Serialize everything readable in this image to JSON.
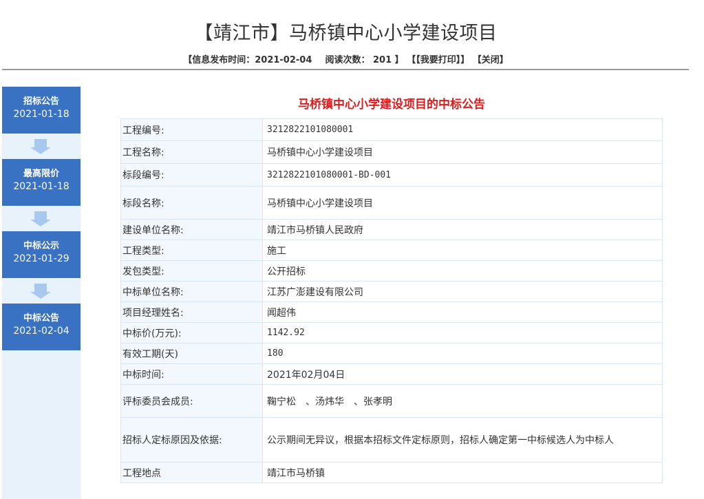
{
  "header": {
    "title": "【靖江市】马桥镇中心小学建设项目",
    "publish_label": "【信息发布时间：",
    "publish_date": "2021-02-04",
    "read_label": "阅读次数：",
    "read_count": "201",
    "read_close": "】",
    "print_link": "【【我要打印】】",
    "close_link": "【关闭】"
  },
  "sidebar": {
    "steps": [
      {
        "label": "招标公告",
        "date": "2021-01-18"
      },
      {
        "label": "最高限价",
        "date": "2021-01-18"
      },
      {
        "label": "中标公示",
        "date": "2021-01-29"
      },
      {
        "label": "中标公告",
        "date": "2021-02-04"
      }
    ],
    "step_color": "#3a72c3",
    "arrow_color": "#a9c8ee"
  },
  "notice": {
    "title": "马桥镇中心小学建设项目的中标公告",
    "title_color": "#e01b1b",
    "rows": [
      {
        "label": "工程编号:",
        "value": "3212822101080001"
      },
      {
        "label": "工程名称:",
        "value": "马桥镇中心小学建设项目"
      },
      {
        "label": "标段编号:",
        "value": "3212822101080001-BD-001"
      },
      {
        "label": "标段名称:",
        "value": "马桥镇中心小学建设项目"
      },
      {
        "label": "建设单位名称:",
        "value": "靖江市马桥镇人民政府"
      },
      {
        "label": "工程类型:",
        "value": "施工"
      },
      {
        "label": "发包类型:",
        "value": "公开招标"
      },
      {
        "label": "中标单位名称:",
        "value": "江苏广澎建设有限公司"
      },
      {
        "label": "项目经理姓名:",
        "value": "闻超伟"
      },
      {
        "label": "中标价(万元):",
        "value": "1142.92"
      },
      {
        "label": "有效工期(天)",
        "value": "180"
      },
      {
        "label": "中标时间:",
        "value": "2021年02月04日"
      },
      {
        "label": "评标委员会成员:",
        "value": "鞠宁松　、汤炜华　、张孝明"
      },
      {
        "label": "招标人定标原因及依据:",
        "value": "公示期间无异议，根据本招标文件定标原则，招标人确定第一中标候选人为中标人"
      },
      {
        "label": "工程地点",
        "value": "靖江市马桥镇"
      }
    ]
  }
}
